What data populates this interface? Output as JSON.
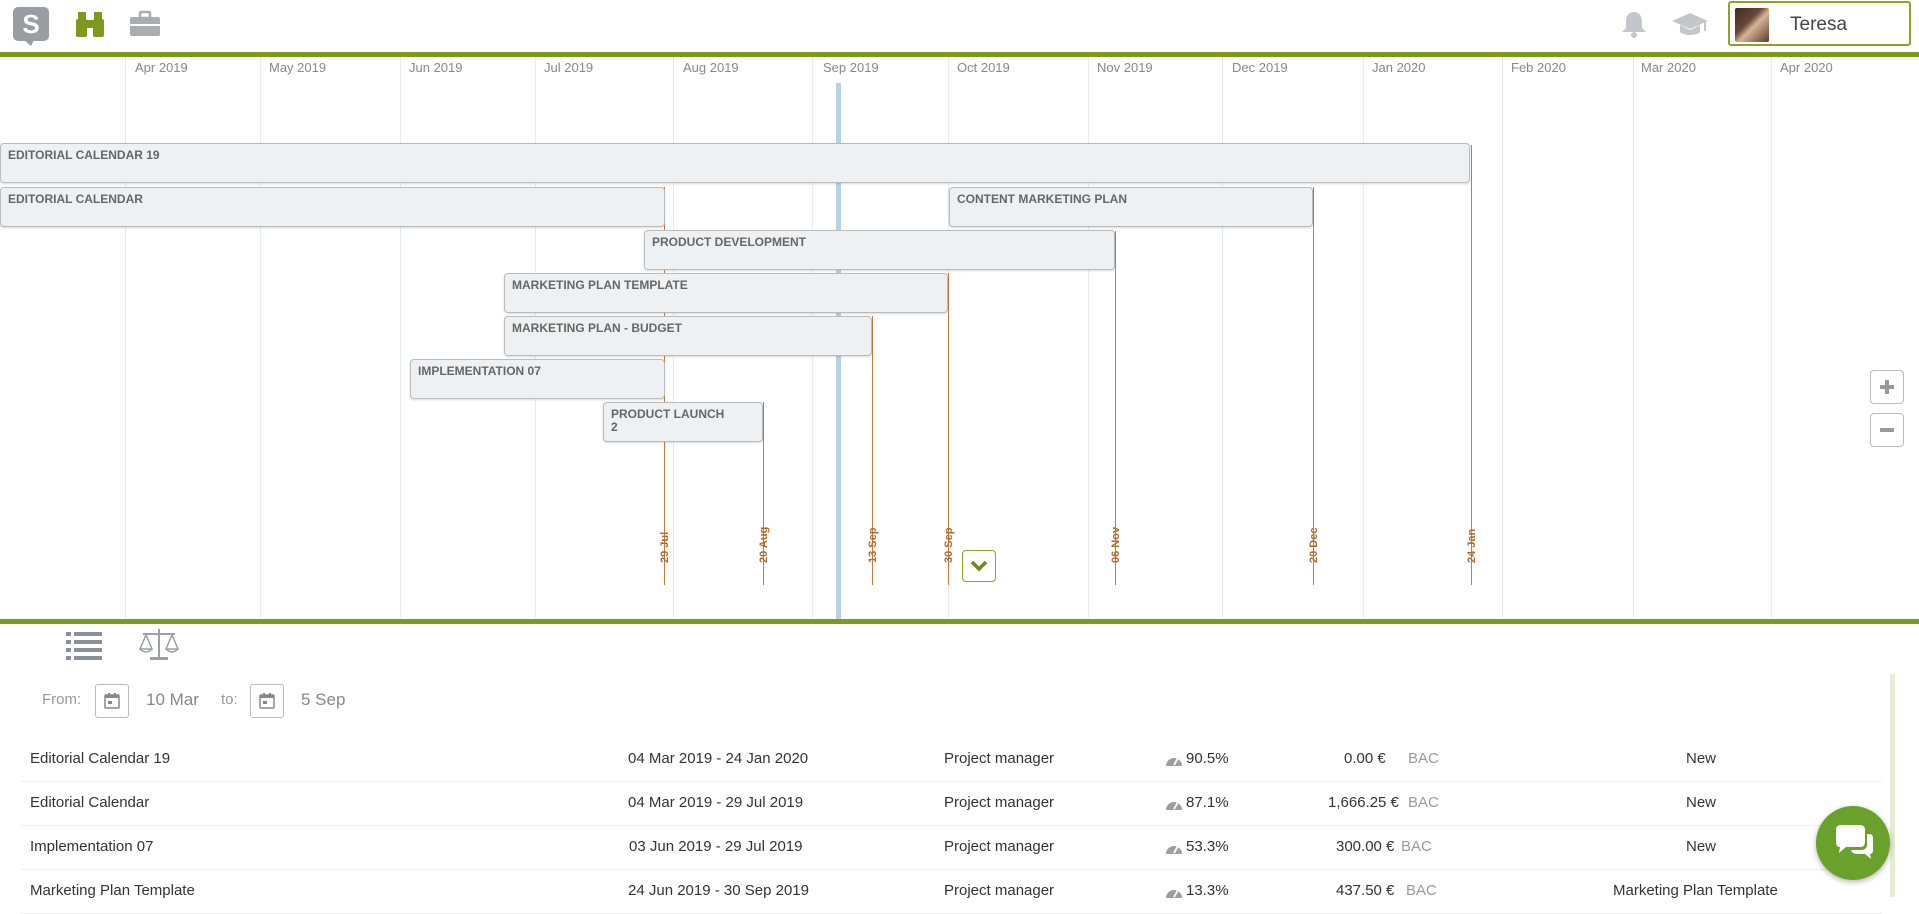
{
  "user": {
    "name": "Teresa"
  },
  "timeline": {
    "months": [
      "Apr 2019",
      "May 2019",
      "Jun 2019",
      "Jul 2019",
      "Aug 2019",
      "Sep 2019",
      "Oct 2019",
      "Nov 2019",
      "Dec 2019",
      "Jan 2020",
      "Feb 2020",
      "Mar 2020",
      "Apr 2020"
    ],
    "bars": [
      {
        "label": "EDITORIAL CALENDAR 19"
      },
      {
        "label": "EDITORIAL CALENDAR"
      },
      {
        "label": "CONTENT MARKETING PLAN"
      },
      {
        "label": "PRODUCT DEVELOPMENT"
      },
      {
        "label": "MARKETING PLAN TEMPLATE"
      },
      {
        "label": "MARKETING PLAN - BUDGET"
      },
      {
        "label": "IMPLEMENTATION 07"
      },
      {
        "label": "PRODUCT LAUNCH 2"
      }
    ],
    "deadlines": [
      "29 Jul",
      "20 Aug",
      "13 Sep",
      "30 Sep",
      "06 Nov",
      "20 Dec",
      "24 Jan"
    ]
  },
  "filter": {
    "from_label": "From:",
    "from_value": "10 Mar",
    "to_label": "to:",
    "to_value": "5 Sep"
  },
  "projects": [
    {
      "name": "Editorial Calendar 19",
      "dates": "04 Mar 2019 - 24 Jan 2020",
      "role": "Project manager",
      "progress": "90.5%",
      "cost": "0.00 €",
      "bac": "BAC",
      "status": "New"
    },
    {
      "name": "Editorial Calendar",
      "dates": "04 Mar 2019 - 29 Jul 2019",
      "role": "Project manager",
      "progress": "87.1%",
      "cost": "1,666.25 €",
      "bac": "BAC",
      "status": "New"
    },
    {
      "name": "Implementation 07",
      "dates": "03 Jun 2019 - 29 Jul 2019",
      "role": "Project manager",
      "progress": "53.3%",
      "cost": "300.00 €",
      "bac": "BAC",
      "status": "New"
    },
    {
      "name": "Marketing Plan Template",
      "dates": "24 Jun 2019 - 30 Sep 2019",
      "role": "Project manager",
      "progress": "13.3%",
      "cost": "437.50 €",
      "bac": "BAC",
      "status": "Marketing Plan Template"
    }
  ],
  "colors": {
    "accent": "#7d9a1e",
    "deadline": "#c87a3a",
    "today": "#b7d2e4",
    "chat": "#6aa12a"
  }
}
